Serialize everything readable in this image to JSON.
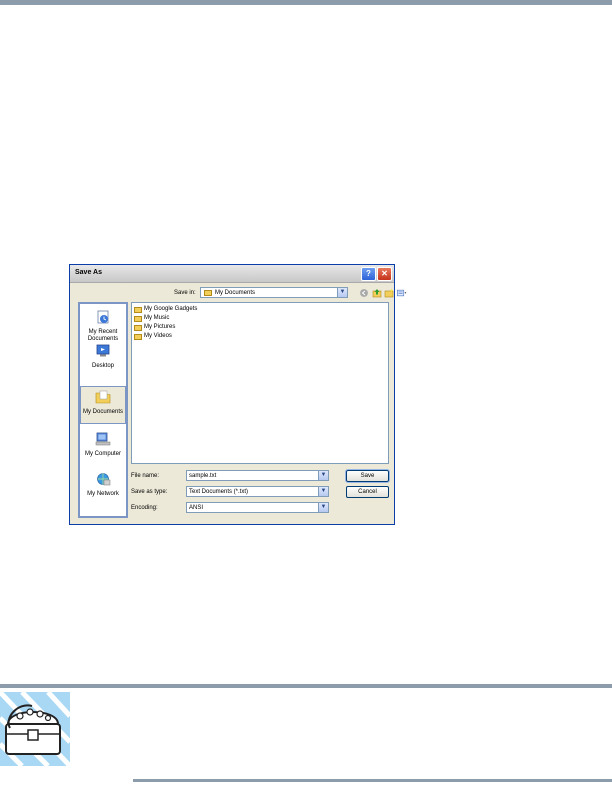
{
  "dialog": {
    "title": "Save As",
    "help_label": "?",
    "close_label": "✕",
    "save_in": {
      "label": "Save in:",
      "value": "My Documents"
    },
    "places": [
      {
        "label": "My Recent\nDocuments",
        "icon": "recent-documents-icon"
      },
      {
        "label": "Desktop",
        "icon": "desktop-icon"
      },
      {
        "label": "My Documents",
        "icon": "my-documents-icon"
      },
      {
        "label": "My Computer",
        "icon": "my-computer-icon"
      },
      {
        "label": "My Network",
        "icon": "my-network-icon"
      }
    ],
    "files": [
      "My Google Gadgets",
      "My Music",
      "My Pictures",
      "My Videos"
    ],
    "file_name": {
      "label": "File name:",
      "value": "sample.txt"
    },
    "save_as_type": {
      "label": "Save as type:",
      "value": "Text Documents (*.txt)"
    },
    "encoding": {
      "label": "Encoding:",
      "value": "ANSI"
    },
    "buttons": {
      "save": "Save",
      "cancel": "Cancel"
    },
    "dropdown_glyph": "▼"
  },
  "colors": {
    "rule": "#8d9cab",
    "dialog_border": "#0b3ea9",
    "places_bar": "#7b96c4",
    "folder": "#f2cf5b"
  }
}
